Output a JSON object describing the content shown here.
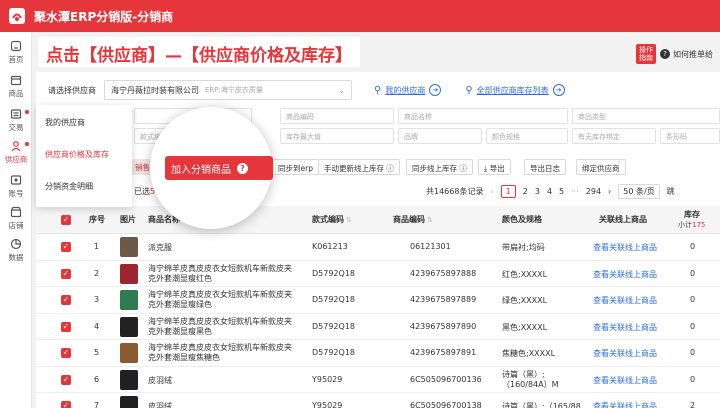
{
  "app": {
    "title": "聚水潭ERP分销版-分销商"
  },
  "rail": {
    "items": [
      {
        "label": "首页",
        "icon": "home-icon"
      },
      {
        "label": "商品",
        "icon": "box-icon"
      },
      {
        "label": "交易",
        "icon": "trade-icon"
      },
      {
        "label": "供应商",
        "icon": "supplier-icon"
      },
      {
        "label": "账号",
        "icon": "account-icon"
      },
      {
        "label": "店铺",
        "icon": "store-icon"
      },
      {
        "label": "数据",
        "icon": "chart-icon"
      }
    ]
  },
  "banner": {
    "text": "点击【供应商】—【供应商价格及库存】"
  },
  "video_link": {
    "tag_line1": "操作",
    "tag_line2": "指南",
    "label": "如何推单给"
  },
  "supplier_row": {
    "label": "请选择供应商",
    "selected": "海宁丹薇拉时装有限公司",
    "hint": "ERP:海宁皮衣质量",
    "my_suppliers": "我的供应商",
    "all_list": "全部供应商库存列表"
  },
  "filters": {
    "row1": [
      "",
      "商品编码",
      "商品名称",
      "商品类型"
    ],
    "row2": [
      "款式编码",
      "库存最大值",
      "品牌",
      "颜色规格",
      "有无库存绑定",
      "条形码"
    ]
  },
  "popover": {
    "items": [
      "我的供应商",
      "供应商价格及库存",
      "分销资金明细"
    ]
  },
  "spotlight": {
    "button": "加入分销商品",
    "question": "?"
  },
  "toolbar": {
    "partial_left": "销售商",
    "buttons": [
      "同步到erp",
      "手动更新线上库存",
      "同步线上库存",
      "导出",
      "导出日志",
      "绑定供应商"
    ],
    "selected_count_prefix": "已选",
    "selected_count": "50条"
  },
  "pager": {
    "total": "共14668条记录",
    "pages": [
      "1",
      "2",
      "3",
      "4",
      "5",
      "···",
      "294"
    ],
    "page_size": "50 条/页",
    "goto": "跳"
  },
  "table": {
    "headers": {
      "seq": "序号",
      "image": "图片",
      "name": "商品名称",
      "style_code": "款式编码",
      "item_code": "商品编码",
      "color_spec": "颜色及规格",
      "linked": "关联线上商品",
      "stock": "库存",
      "stock_sub_label": "小计",
      "stock_sub_value": "175"
    },
    "rows": [
      {
        "seq": "1",
        "name": "派克服",
        "style": "K061213",
        "code": "06121301",
        "spec": "带扁衬;均码",
        "link": "查看关联线上商品",
        "stock": "0",
        "thumb": "#6b5a4a"
      },
      {
        "seq": "2",
        "name": "海宁绵羊皮真皮皮衣女短款机车新款皮夹克外套潮显瘦红色",
        "style": "D5792Q18",
        "code": "4239675897888",
        "spec": "红色;XXXXL",
        "link": "查看关联线上商品",
        "stock": "0",
        "thumb": "#9b2630"
      },
      {
        "seq": "3",
        "name": "海宁绵羊皮真皮皮衣女短款机车新款皮夹克外套潮显瘦绿色",
        "style": "D5792Q18",
        "code": "4239675897889",
        "spec": "绿色;XXXXL",
        "link": "查看关联线上商品",
        "stock": "0",
        "thumb": "#2f7a4e"
      },
      {
        "seq": "4",
        "name": "海宁绵羊皮真皮皮衣女短款机车新款皮夹克外套潮显瘦黑色",
        "style": "D5792Q18",
        "code": "4239675897890",
        "spec": "黑色;XXXXL",
        "link": "查看关联线上商品",
        "stock": "0",
        "thumb": "#222222"
      },
      {
        "seq": "5",
        "name": "海宁绵羊皮真皮皮衣女短款机车新款皮夹克外套潮显瘦焦糖色",
        "style": "D5792Q18",
        "code": "4239675897891",
        "spec": "焦糖色;XXXXL",
        "link": "查看关联线上商品",
        "stock": "0",
        "thumb": "#8a5a32"
      },
      {
        "seq": "6",
        "name": "皮羽绒",
        "style": "Y95029",
        "code": "6C505096700136",
        "spec": "诗篇（黑）;（160/84A）M",
        "link": "查看关联线上商品",
        "stock": "0",
        "thumb": "#1f1f24"
      },
      {
        "seq": "7",
        "name": "皮羽绒",
        "style": "Y95029",
        "code": "6C505096700138",
        "spec": "诗篇（黑）;（165/88",
        "link": "查看关联线上商品",
        "stock": "2",
        "thumb": "#1f1f24"
      }
    ]
  },
  "colors": {
    "brand_red": "#e5373b",
    "link_blue": "#2b6de5"
  }
}
